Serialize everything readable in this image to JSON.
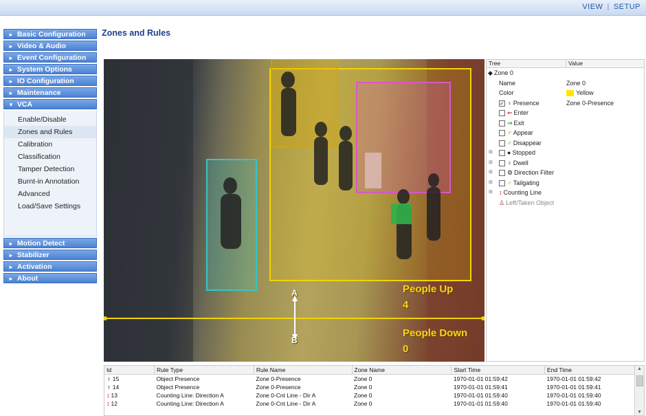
{
  "topnav": {
    "view": "VIEW",
    "separator": "|",
    "setup": "SETUP"
  },
  "page_title": "Zones and Rules",
  "sidebar": {
    "menu": [
      "Basic Configuration",
      "Video & Audio",
      "Event Configuration",
      "System Options",
      "IO Configuration",
      "Maintenance",
      "VCA"
    ],
    "vca_items": [
      "Enable/Disable",
      "Zones and Rules",
      "Calibration",
      "Classification",
      "Tamper Detection",
      "Burnt-in Annotation",
      "Advanced",
      "Load/Save Settings"
    ],
    "menu2": [
      "Motion Detect",
      "Stabilizer",
      "Activation",
      "About"
    ],
    "arrow_collapsed": "►",
    "arrow_expanded": "▼"
  },
  "video": {
    "people_up_label": "People Up",
    "people_up_count": "4",
    "people_down_label": "People Down",
    "people_down_count": "0",
    "line_label_a": "A",
    "line_label_b": "B",
    "colors": {
      "zone_yellow": "#f2d400",
      "zone_cyan": "#34c6c6",
      "zone_pink": "#d957c8",
      "zone_orange": "#d9a400"
    }
  },
  "tree": {
    "header_tree": "Tree",
    "header_value": "Value",
    "root": "Zone 0",
    "name_label": "Name",
    "name_value": "Zone 0",
    "color_label": "Color",
    "color_value": "Yellow",
    "presence_label": "Presence",
    "presence_value": "Zone 0-Presence",
    "rules": [
      "Enter",
      "Exit",
      "Appear",
      "Disappear",
      "Stopped",
      "Dwell",
      "Direction Filter",
      "Tailgating",
      "Counting Line",
      "Left/Taken Object"
    ]
  },
  "log": {
    "headers": [
      "Id",
      "Rule Type",
      "Rule Name",
      "Zone Name",
      "Start Time",
      "End Time"
    ],
    "rows": [
      {
        "id": "15",
        "type": "Object Presence",
        "name": "Zone 0-Presence",
        "zone": "Zone 0",
        "start": "1970-01-01 01:59:42",
        "end": "1970-01-01 01:59:42",
        "icon": "presence-icon"
      },
      {
        "id": "14",
        "type": "Object Presence",
        "name": "Zone 0-Presence",
        "zone": "Zone 0",
        "start": "1970-01-01 01:59:41",
        "end": "1970-01-01 01:59:41",
        "icon": "presence-icon"
      },
      {
        "id": "13",
        "type": "Counting Line: Direction A",
        "name": "Zone 0-Cnt Line - Dir A",
        "zone": "Zone 0",
        "start": "1970-01-01 01:59:40",
        "end": "1970-01-01 01:59:40",
        "icon": "counting-line-icon"
      },
      {
        "id": "12",
        "type": "Counting Line: Direction A",
        "name": "Zone 0-Cnt Line - Dir A",
        "zone": "Zone 0",
        "start": "1970-01-01 01:59:40",
        "end": "1970-01-01 01:59:40",
        "icon": "counting-line-icon"
      }
    ]
  }
}
